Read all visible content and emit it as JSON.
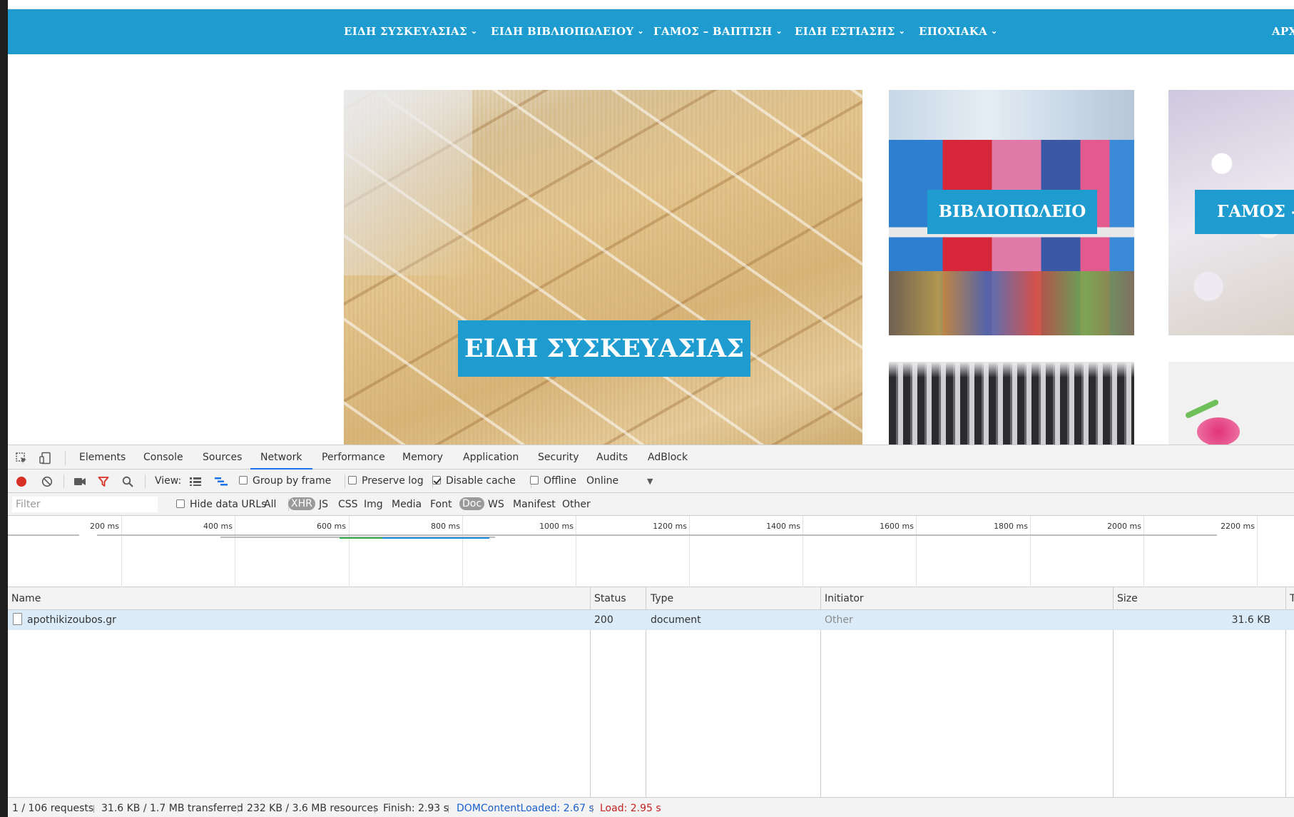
{
  "site": {
    "nav": [
      {
        "label": "ΕΙΔΗ ΣΥΣΚΕΥΑΣΙΑΣ"
      },
      {
        "label": "ΕΙΔΗ ΒΙΒΛΙΟΠΩΛΕΙΟΥ"
      },
      {
        "label": "ΓΑΜΟΣ – ΒΑΠΤΙΣΗ"
      },
      {
        "label": "ΕΙΔΗ ΕΣΤΙΑΣΗΣ"
      },
      {
        "label": "ΕΠΟΧΙΑΚΑ"
      },
      {
        "label": "ΑΡΧ"
      }
    ],
    "tiles": {
      "packaging": "ΕΙΔΗ ΣΥΣΚΕΥΑΣΙΑΣ",
      "bookstore": "ΒΙΒΛΙΟΠΩΛΕΙΟ",
      "wedding": "ΓΑΜΟΣ - Β"
    },
    "colors": {
      "brand": "#1e9cd0"
    }
  },
  "devtools": {
    "tabs": [
      "Elements",
      "Console",
      "Sources",
      "Network",
      "Performance",
      "Memory",
      "Application",
      "Security",
      "Audits",
      "AdBlock"
    ],
    "active_tab": "Network",
    "toolbar": {
      "view_label": "View:",
      "group_by_frame": "Group by frame",
      "preserve_log": "Preserve log",
      "disable_cache": "Disable cache",
      "offline": "Offline",
      "throttle": "Online"
    },
    "filter": {
      "placeholder": "Filter",
      "hide_data_urls": "Hide data URLs",
      "types": [
        "All",
        "XHR",
        "JS",
        "CSS",
        "Img",
        "Media",
        "Font",
        "Doc",
        "WS",
        "Manifest",
        "Other"
      ],
      "highlighted": [
        "XHR",
        "Doc"
      ]
    },
    "timeline": {
      "ticks": [
        "200 ms",
        "400 ms",
        "600 ms",
        "800 ms",
        "1000 ms",
        "1200 ms",
        "1400 ms",
        "1600 ms",
        "1800 ms",
        "2000 ms",
        "2200 ms"
      ]
    },
    "table": {
      "columns": [
        "Name",
        "Status",
        "Type",
        "Initiator",
        "Size",
        "T"
      ],
      "rows": [
        {
          "name": "apothikizoubos.gr",
          "status": "200",
          "type": "document",
          "initiator": "Other",
          "size": "31.6 KB"
        }
      ]
    },
    "status_bar": {
      "requests": "1 / 106 requests",
      "transferred": "31.6 KB / 1.7 MB transferred",
      "resources": "232 KB / 3.6 MB resources",
      "finish": "Finish: 2.93 s",
      "dom_content_loaded": "DOMContentLoaded: 2.67 s",
      "load": "Load: 2.95 s"
    }
  }
}
